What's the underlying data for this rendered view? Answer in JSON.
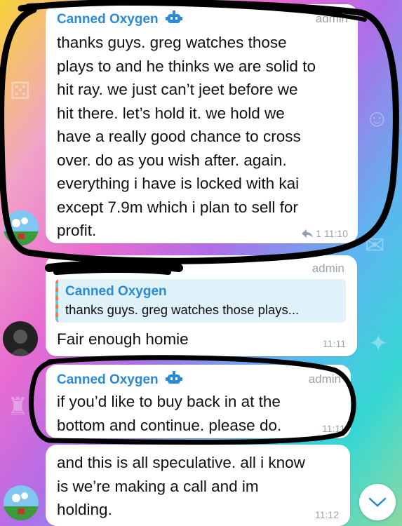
{
  "messages": [
    {
      "sender": "Canned Oxygen",
      "role": "admin",
      "lines": [
        "thanks guys. greg watches those",
        "plays to and he thinks we are solid to",
        "hit ray. we just can’t jeet before we",
        "hit there. let’s hold it. we hold we",
        "have a really good chance to cross",
        "over. do as you wish after. again.",
        "everything i have is locked with kai",
        "except 7.9m which i plan to sell for",
        "profit."
      ],
      "time": "11:10",
      "reply_count": "1"
    },
    {
      "role": "admin",
      "quote_sender": "Canned Oxygen",
      "quote_text": "thanks guys. greg watches those plays...",
      "text": "Fair enough homie",
      "time": "11:11"
    },
    {
      "sender": "Canned Oxygen",
      "role": "admin",
      "lines": [
        "if you’d like to buy back in at the",
        "bottom and continue. please do."
      ],
      "time": "11:11"
    },
    {
      "lines": [
        "and this is all speculative. all i know",
        "is we’re making a call and im",
        "holding."
      ],
      "time": "11:12"
    }
  ],
  "colors": {
    "sender": "#2a8ad6",
    "bubble": "#ffffff",
    "annotation": "#000000"
  },
  "icons": {
    "bot": "robot-face-icon",
    "reply": "reply-arrow-icon",
    "scroll": "chevron-down-icon"
  }
}
